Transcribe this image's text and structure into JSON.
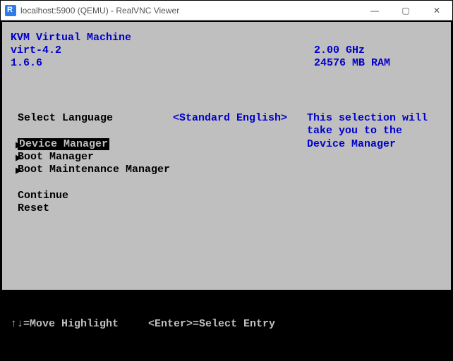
{
  "window": {
    "title": "localhost:5900 (QEMU) - RealVNC Viewer",
    "min_label": "—",
    "max_label": "▢",
    "close_label": "✕"
  },
  "header": {
    "line1": "KVM Virtual Machine",
    "line2_left": "virt-4.2",
    "line2_right": "2.00 GHz",
    "line3_left": "1.6.6",
    "line3_right": "24576 MB RAM"
  },
  "menu": {
    "language_label": "Select Language",
    "language_value": "<Standard English>",
    "items": [
      {
        "label": "Device Manager",
        "selected": true
      },
      {
        "label": "Boot Manager",
        "selected": false
      },
      {
        "label": "Boot Maintenance Manager",
        "selected": false
      }
    ],
    "continue_label": "Continue",
    "reset_label": "Reset",
    "arrow": "▶"
  },
  "help": {
    "line1": "This selection will",
    "line2": "take you to the",
    "line3": "Device Manager"
  },
  "footer": {
    "move_hint": "↑↓=Move Highlight",
    "select_hint": "<Enter>=Select Entry"
  }
}
